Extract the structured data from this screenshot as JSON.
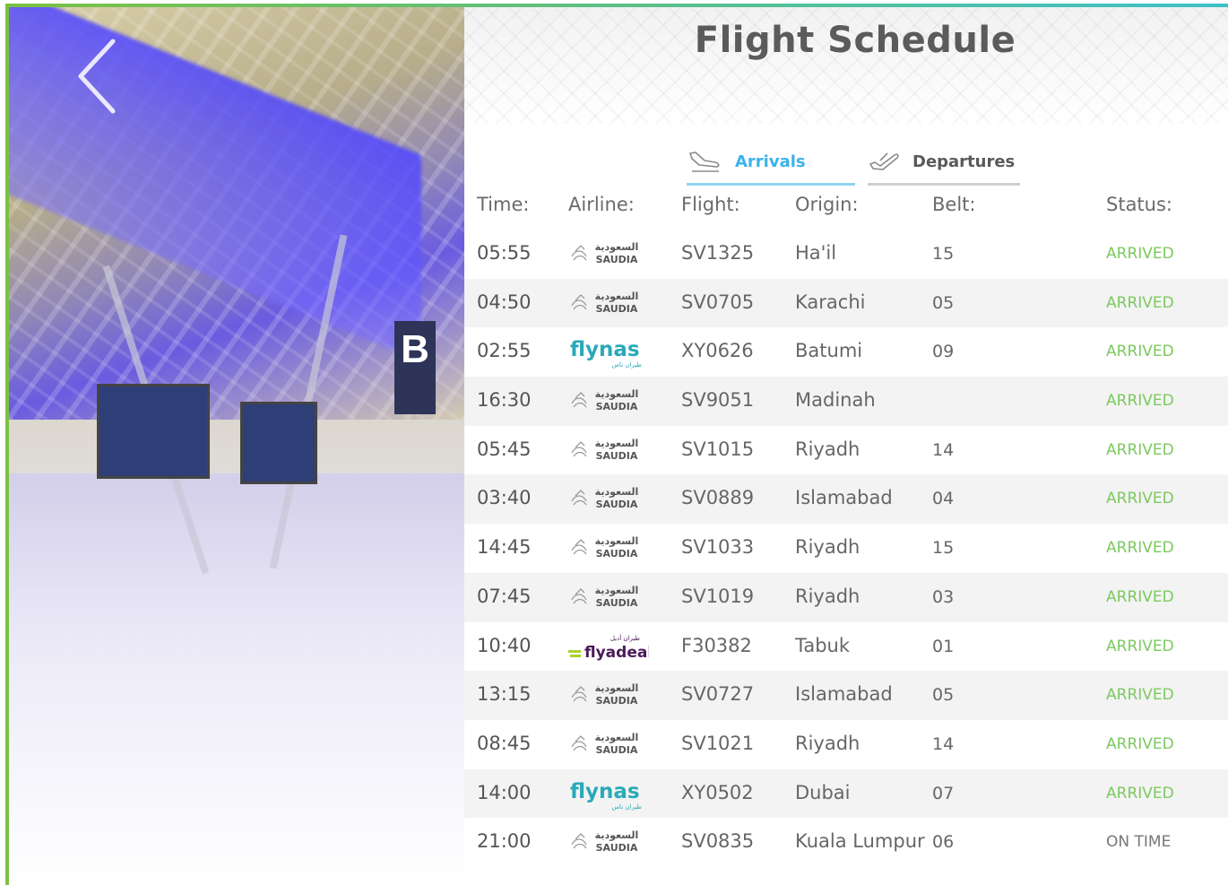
{
  "page": {
    "title": "Flight Schedule"
  },
  "tabs": {
    "arrivals": {
      "label": "Arrivals",
      "active": true
    },
    "departures": {
      "label": "Departures",
      "active": false
    }
  },
  "photo": {
    "sign_text": "B"
  },
  "table": {
    "headers": {
      "time": "Time:",
      "airline": "Airline:",
      "flight": "Flight:",
      "origin": "Origin:",
      "belt": "Belt:",
      "status": "Status:"
    },
    "rows": [
      {
        "time": "05:55",
        "airline": "saudia",
        "flight": "SV1325",
        "origin": "Ha'il",
        "belt": "15",
        "status": "ARRIVED"
      },
      {
        "time": "04:50",
        "airline": "saudia",
        "flight": "SV0705",
        "origin": "Karachi",
        "belt": "05",
        "status": "ARRIVED"
      },
      {
        "time": "02:55",
        "airline": "flynas",
        "flight": "XY0626",
        "origin": "Batumi",
        "belt": "09",
        "status": "ARRIVED"
      },
      {
        "time": "16:30",
        "airline": "saudia",
        "flight": "SV9051",
        "origin": "Madinah",
        "belt": "",
        "status": "ARRIVED"
      },
      {
        "time": "05:45",
        "airline": "saudia",
        "flight": "SV1015",
        "origin": "Riyadh",
        "belt": "14",
        "status": "ARRIVED"
      },
      {
        "time": "03:40",
        "airline": "saudia",
        "flight": "SV0889",
        "origin": "Islamabad",
        "belt": "04",
        "status": "ARRIVED"
      },
      {
        "time": "14:45",
        "airline": "saudia",
        "flight": "SV1033",
        "origin": "Riyadh",
        "belt": "15",
        "status": "ARRIVED"
      },
      {
        "time": "07:45",
        "airline": "saudia",
        "flight": "SV1019",
        "origin": "Riyadh",
        "belt": "03",
        "status": "ARRIVED"
      },
      {
        "time": "10:40",
        "airline": "flyadeal",
        "flight": "F30382",
        "origin": "Tabuk",
        "belt": "01",
        "status": "ARRIVED"
      },
      {
        "time": "13:15",
        "airline": "saudia",
        "flight": "SV0727",
        "origin": "Islamabad",
        "belt": "05",
        "status": "ARRIVED"
      },
      {
        "time": "08:45",
        "airline": "saudia",
        "flight": "SV1021",
        "origin": "Riyadh",
        "belt": "14",
        "status": "ARRIVED"
      },
      {
        "time": "14:00",
        "airline": "flynas",
        "flight": "XY0502",
        "origin": "Dubai",
        "belt": "07",
        "status": "ARRIVED"
      },
      {
        "time": "21:00",
        "airline": "saudia",
        "flight": "SV0835",
        "origin": "Kuala Lumpur",
        "belt": "06",
        "status": "ON TIME"
      }
    ]
  },
  "logos": {
    "saudia": {
      "arabic": "السعودية",
      "latin": "SAUDIA",
      "color": "#4a4a4a"
    },
    "flynas": {
      "arabic": "طيران ناس",
      "latin": "flynas",
      "color": "#2aa9b8"
    },
    "flyadeal": {
      "arabic": "طيران أديل",
      "latin": "flyadeal",
      "color": "#4a1a5a",
      "accent": "#a8d22a"
    }
  },
  "colors": {
    "arrived": "#7cc95f",
    "on_time": "#777777",
    "active_tab": "#3ab3ea",
    "frame_green": "#7ac143"
  },
  "icons": {
    "back": "chevron-left-icon",
    "arrivals": "plane-landing-icon",
    "departures": "plane-takeoff-icon"
  }
}
